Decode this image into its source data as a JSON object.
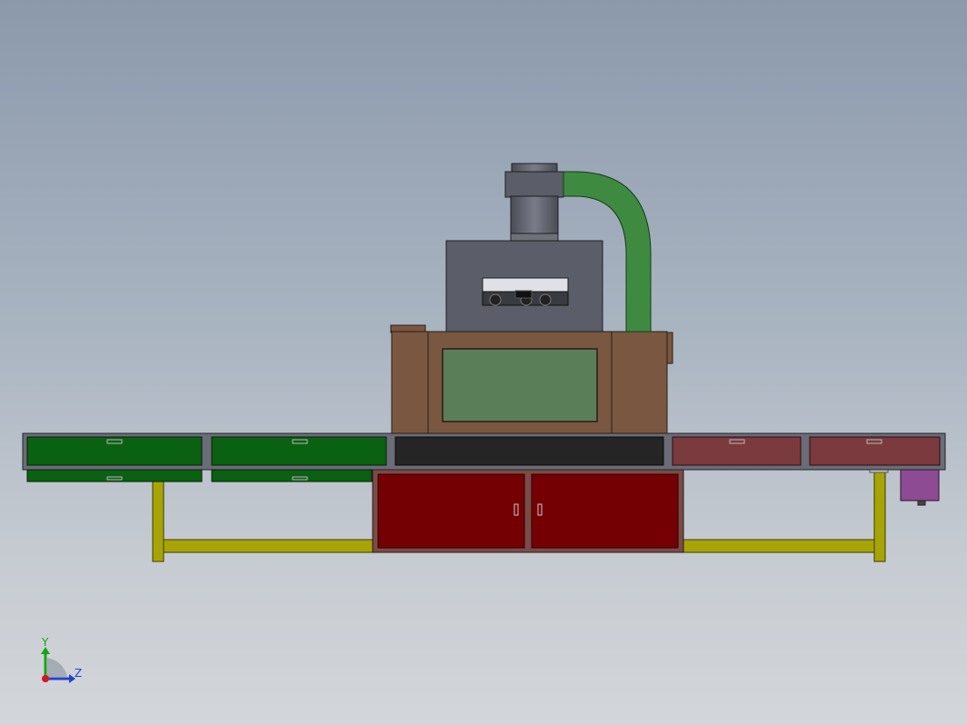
{
  "viewport": {
    "background_top": "#8b99ab",
    "background_bottom": "#d3d6da"
  },
  "model": {
    "conveyor_left_drawers": [
      "green-drawer",
      "green-drawer"
    ],
    "conveyor_center_panel": "black-panel",
    "conveyor_right_drawers": [
      "red-drawer",
      "red-drawer"
    ],
    "cabinet_doors": [
      "red-door",
      "red-door"
    ],
    "colors": {
      "frame": "#6a6d78",
      "green_drawer": "#0a6112",
      "black_panel": "#252525",
      "red_drawer": "#7b3a3d",
      "cabinet_body": "#7b4b45",
      "cabinet_door": "#750004",
      "upper_housing": "#7a5740",
      "window": "#5a7f58",
      "lamp_box": "#5b5d68",
      "duct": "#3f8a41",
      "legs": "#a7a407",
      "motor": "#8c4b93"
    }
  },
  "triad": {
    "y_label": "Y",
    "z_label": "Z",
    "y_color": "#18a318",
    "z_color": "#2244cc",
    "origin_color": "#d11a1a"
  }
}
